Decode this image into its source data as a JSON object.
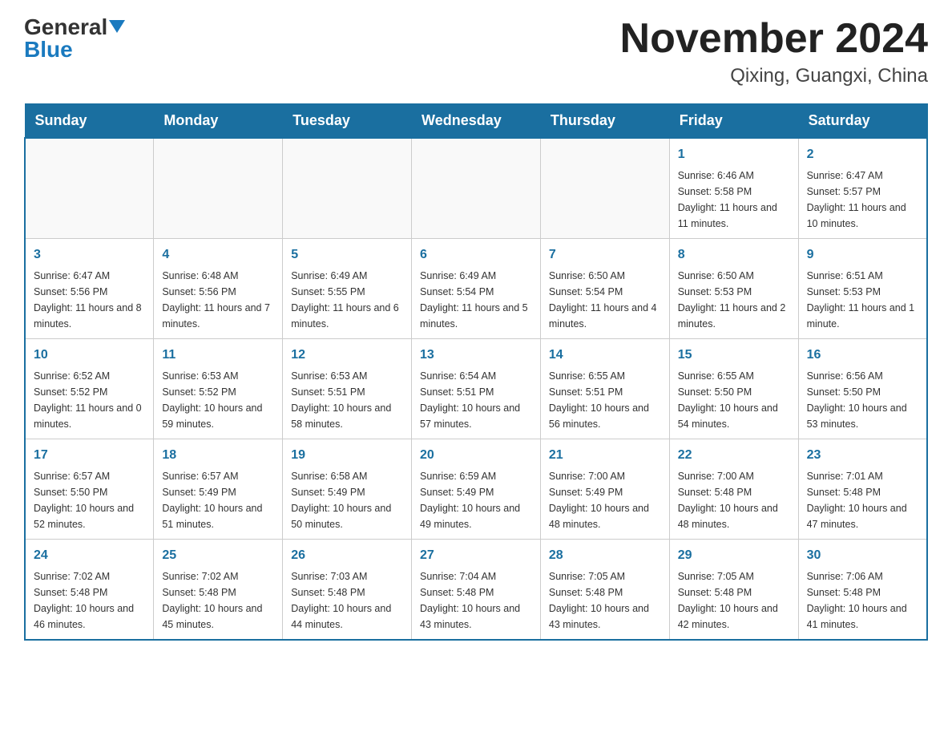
{
  "header": {
    "logo_general": "General",
    "logo_blue": "Blue",
    "title": "November 2024",
    "subtitle": "Qixing, Guangxi, China"
  },
  "calendar": {
    "days_of_week": [
      "Sunday",
      "Monday",
      "Tuesday",
      "Wednesday",
      "Thursday",
      "Friday",
      "Saturday"
    ],
    "weeks": [
      [
        {
          "day": "",
          "info": ""
        },
        {
          "day": "",
          "info": ""
        },
        {
          "day": "",
          "info": ""
        },
        {
          "day": "",
          "info": ""
        },
        {
          "day": "",
          "info": ""
        },
        {
          "day": "1",
          "info": "Sunrise: 6:46 AM\nSunset: 5:58 PM\nDaylight: 11 hours and 11 minutes."
        },
        {
          "day": "2",
          "info": "Sunrise: 6:47 AM\nSunset: 5:57 PM\nDaylight: 11 hours and 10 minutes."
        }
      ],
      [
        {
          "day": "3",
          "info": "Sunrise: 6:47 AM\nSunset: 5:56 PM\nDaylight: 11 hours and 8 minutes."
        },
        {
          "day": "4",
          "info": "Sunrise: 6:48 AM\nSunset: 5:56 PM\nDaylight: 11 hours and 7 minutes."
        },
        {
          "day": "5",
          "info": "Sunrise: 6:49 AM\nSunset: 5:55 PM\nDaylight: 11 hours and 6 minutes."
        },
        {
          "day": "6",
          "info": "Sunrise: 6:49 AM\nSunset: 5:54 PM\nDaylight: 11 hours and 5 minutes."
        },
        {
          "day": "7",
          "info": "Sunrise: 6:50 AM\nSunset: 5:54 PM\nDaylight: 11 hours and 4 minutes."
        },
        {
          "day": "8",
          "info": "Sunrise: 6:50 AM\nSunset: 5:53 PM\nDaylight: 11 hours and 2 minutes."
        },
        {
          "day": "9",
          "info": "Sunrise: 6:51 AM\nSunset: 5:53 PM\nDaylight: 11 hours and 1 minute."
        }
      ],
      [
        {
          "day": "10",
          "info": "Sunrise: 6:52 AM\nSunset: 5:52 PM\nDaylight: 11 hours and 0 minutes."
        },
        {
          "day": "11",
          "info": "Sunrise: 6:53 AM\nSunset: 5:52 PM\nDaylight: 10 hours and 59 minutes."
        },
        {
          "day": "12",
          "info": "Sunrise: 6:53 AM\nSunset: 5:51 PM\nDaylight: 10 hours and 58 minutes."
        },
        {
          "day": "13",
          "info": "Sunrise: 6:54 AM\nSunset: 5:51 PM\nDaylight: 10 hours and 57 minutes."
        },
        {
          "day": "14",
          "info": "Sunrise: 6:55 AM\nSunset: 5:51 PM\nDaylight: 10 hours and 56 minutes."
        },
        {
          "day": "15",
          "info": "Sunrise: 6:55 AM\nSunset: 5:50 PM\nDaylight: 10 hours and 54 minutes."
        },
        {
          "day": "16",
          "info": "Sunrise: 6:56 AM\nSunset: 5:50 PM\nDaylight: 10 hours and 53 minutes."
        }
      ],
      [
        {
          "day": "17",
          "info": "Sunrise: 6:57 AM\nSunset: 5:50 PM\nDaylight: 10 hours and 52 minutes."
        },
        {
          "day": "18",
          "info": "Sunrise: 6:57 AM\nSunset: 5:49 PM\nDaylight: 10 hours and 51 minutes."
        },
        {
          "day": "19",
          "info": "Sunrise: 6:58 AM\nSunset: 5:49 PM\nDaylight: 10 hours and 50 minutes."
        },
        {
          "day": "20",
          "info": "Sunrise: 6:59 AM\nSunset: 5:49 PM\nDaylight: 10 hours and 49 minutes."
        },
        {
          "day": "21",
          "info": "Sunrise: 7:00 AM\nSunset: 5:49 PM\nDaylight: 10 hours and 48 minutes."
        },
        {
          "day": "22",
          "info": "Sunrise: 7:00 AM\nSunset: 5:48 PM\nDaylight: 10 hours and 48 minutes."
        },
        {
          "day": "23",
          "info": "Sunrise: 7:01 AM\nSunset: 5:48 PM\nDaylight: 10 hours and 47 minutes."
        }
      ],
      [
        {
          "day": "24",
          "info": "Sunrise: 7:02 AM\nSunset: 5:48 PM\nDaylight: 10 hours and 46 minutes."
        },
        {
          "day": "25",
          "info": "Sunrise: 7:02 AM\nSunset: 5:48 PM\nDaylight: 10 hours and 45 minutes."
        },
        {
          "day": "26",
          "info": "Sunrise: 7:03 AM\nSunset: 5:48 PM\nDaylight: 10 hours and 44 minutes."
        },
        {
          "day": "27",
          "info": "Sunrise: 7:04 AM\nSunset: 5:48 PM\nDaylight: 10 hours and 43 minutes."
        },
        {
          "day": "28",
          "info": "Sunrise: 7:05 AM\nSunset: 5:48 PM\nDaylight: 10 hours and 43 minutes."
        },
        {
          "day": "29",
          "info": "Sunrise: 7:05 AM\nSunset: 5:48 PM\nDaylight: 10 hours and 42 minutes."
        },
        {
          "day": "30",
          "info": "Sunrise: 7:06 AM\nSunset: 5:48 PM\nDaylight: 10 hours and 41 minutes."
        }
      ]
    ]
  }
}
